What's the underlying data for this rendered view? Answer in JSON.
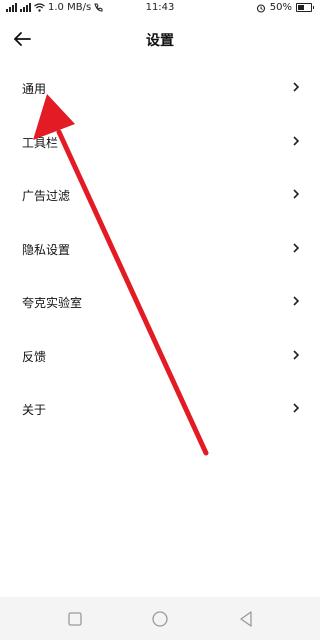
{
  "status_bar": {
    "network_speed": "1.0 MB/s",
    "time": "11:43",
    "battery": "50%",
    "battery_level": 0.5,
    "icons": [
      "signal-icon",
      "wifi-icon",
      "call-icon",
      "alarm-icon",
      "battery-icon"
    ]
  },
  "header": {
    "title": "设置",
    "back_icon": "back-arrow-icon"
  },
  "menu": {
    "items": [
      {
        "label": "通用"
      },
      {
        "label": "工具栏"
      },
      {
        "label": "广告过滤"
      },
      {
        "label": "隐私设置"
      },
      {
        "label": "夸克实验室"
      },
      {
        "label": "反馈"
      },
      {
        "label": "关于"
      }
    ],
    "chevron_icon": "chevron-right-icon"
  },
  "nav_bar": {
    "icons": [
      "recent-apps-icon",
      "home-icon",
      "back-icon"
    ]
  },
  "annotation": {
    "color": "#e21b25",
    "points_to": "通用"
  }
}
